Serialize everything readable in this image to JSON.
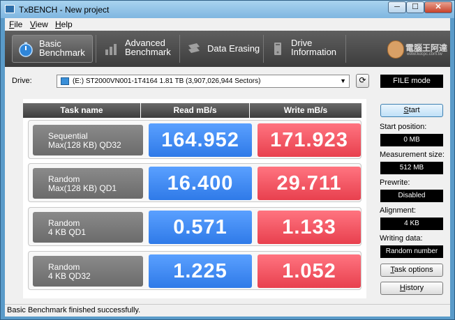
{
  "window": {
    "title": "TxBENCH - New project",
    "min_glyph": "─",
    "max_glyph": "☐",
    "close_glyph": "✕"
  },
  "menu": [
    {
      "key": "F",
      "rest": "ile"
    },
    {
      "key": "V",
      "rest": "iew"
    },
    {
      "key": "H",
      "rest": "elp"
    }
  ],
  "toolbar": {
    "basic": {
      "line1": "Basic",
      "line2": "Benchmark"
    },
    "advanced": {
      "line1": "Advanced",
      "line2": "Benchmark"
    },
    "erasing": {
      "line1": "Data Erasing"
    },
    "drive_info": {
      "line1": "Drive",
      "line2": "Information"
    },
    "logo_text": "電腦王阿達",
    "logo_sub": "www.kocpc.com.tw"
  },
  "drive": {
    "label": "Drive:",
    "value": "(E:) ST2000VN001-1T4164  1.81 TB (3,907,026,944 Sectors)",
    "dropdown_glyph": "▼",
    "refresh_glyph": "⟳",
    "mode": "FILE mode"
  },
  "table": {
    "headers": [
      "Task name",
      "Read mB/s",
      "Write mB/s"
    ],
    "rows": [
      {
        "line1": "Sequential",
        "line2": "Max(128 KB) QD32",
        "read": "164.952",
        "write": "171.923"
      },
      {
        "line1": "Random",
        "line2": "Max(128 KB) QD1",
        "read": "16.400",
        "write": "29.711"
      },
      {
        "line1": "Random",
        "line2": "4 KB QD1",
        "read": "0.571",
        "write": "1.133"
      },
      {
        "line1": "Random",
        "line2": "4 KB QD32",
        "read": "1.225",
        "write": "1.052"
      }
    ]
  },
  "side": {
    "start_key": "S",
    "start_rest": "tart",
    "start_position_label": "Start position:",
    "start_position": "0 MB",
    "measurement_size_label": "Measurement size:",
    "measurement_size": "512 MB",
    "prewrite_label": "Prewrite:",
    "prewrite": "Disabled",
    "alignment_label": "Alignment:",
    "alignment": "4 KB",
    "writing_data_label": "Writing data:",
    "writing_data": "Random number",
    "task_options_key": "T",
    "task_options_rest": "ask options",
    "history_key": "H",
    "history_rest": "istory"
  },
  "status": "Basic Benchmark finished successfully."
}
